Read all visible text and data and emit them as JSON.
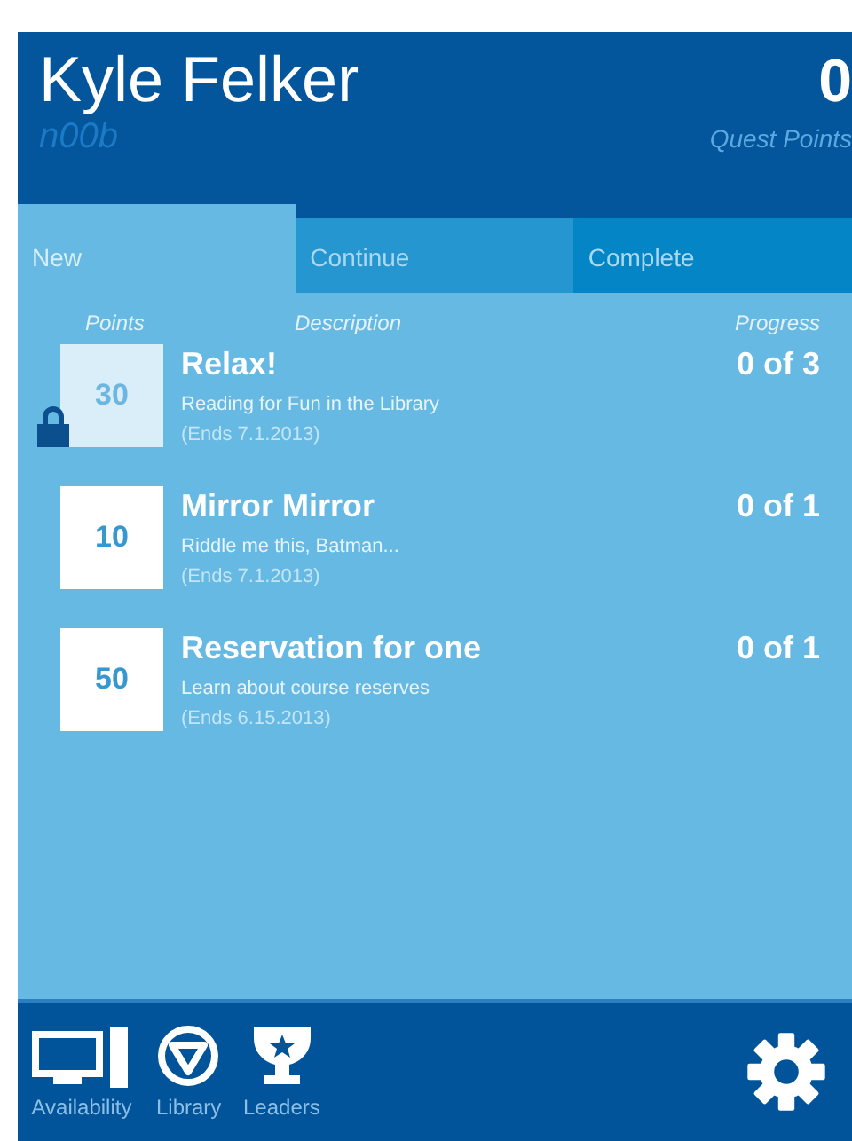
{
  "profile": {
    "name": "Kyle Felker",
    "rank": "n00b",
    "points": "0",
    "points_label": "Quest Points"
  },
  "tabs": [
    {
      "label": "New",
      "selected": true
    },
    {
      "label": "Continue",
      "selected": false
    },
    {
      "label": "Complete",
      "selected": false
    }
  ],
  "columns": [
    "Points",
    "Description",
    "Progress"
  ],
  "quests": [
    {
      "points": "30",
      "title": "Relax!",
      "description": "Reading for Fun in the Library",
      "ends": "(Ends 7.1.2013)",
      "progress": "0 of 3",
      "locked": true
    },
    {
      "points": "10",
      "title": "Mirror Mirror",
      "description": "Riddle me this, Batman...",
      "ends": "(Ends 7.1.2013)",
      "progress": "0 of 1",
      "locked": false
    },
    {
      "points": "50",
      "title": "Reservation for one",
      "description": "Learn about course reserves",
      "ends": "(Ends 6.15.2013)",
      "progress": "0 of 1",
      "locked": false
    }
  ],
  "nav": [
    {
      "label": "Availability",
      "kind": "computer"
    },
    {
      "label": "Library",
      "kind": "logo"
    },
    {
      "label": "Leaders",
      "kind": "trophy"
    }
  ]
}
